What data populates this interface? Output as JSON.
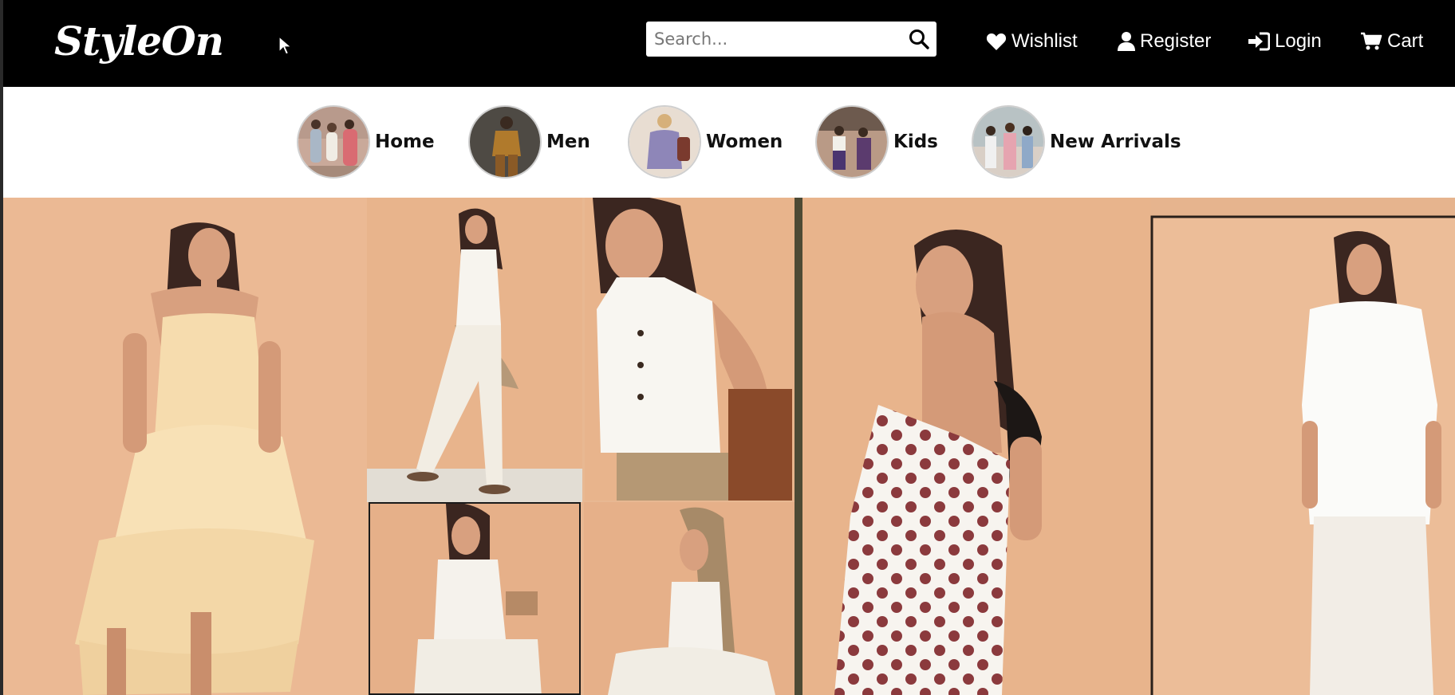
{
  "header": {
    "logo": "StyleOn",
    "search": {
      "placeholder": "Search...",
      "value": ""
    },
    "links": {
      "wishlist": "Wishlist",
      "register": "Register",
      "login": "Login",
      "cart": "Cart"
    }
  },
  "categories": [
    {
      "label": "Home",
      "icon": "family-avatar"
    },
    {
      "label": "Men",
      "icon": "men-avatar"
    },
    {
      "label": "Women",
      "icon": "women-avatar"
    },
    {
      "label": "Kids",
      "icon": "kids-avatar"
    },
    {
      "label": "New Arrivals",
      "icon": "new-arrivals-avatar"
    }
  ],
  "colors": {
    "header_bg": "#000000",
    "page_bg": "#ffffff",
    "hero_backdrop": "#e8b892",
    "text_dark": "#111111"
  }
}
